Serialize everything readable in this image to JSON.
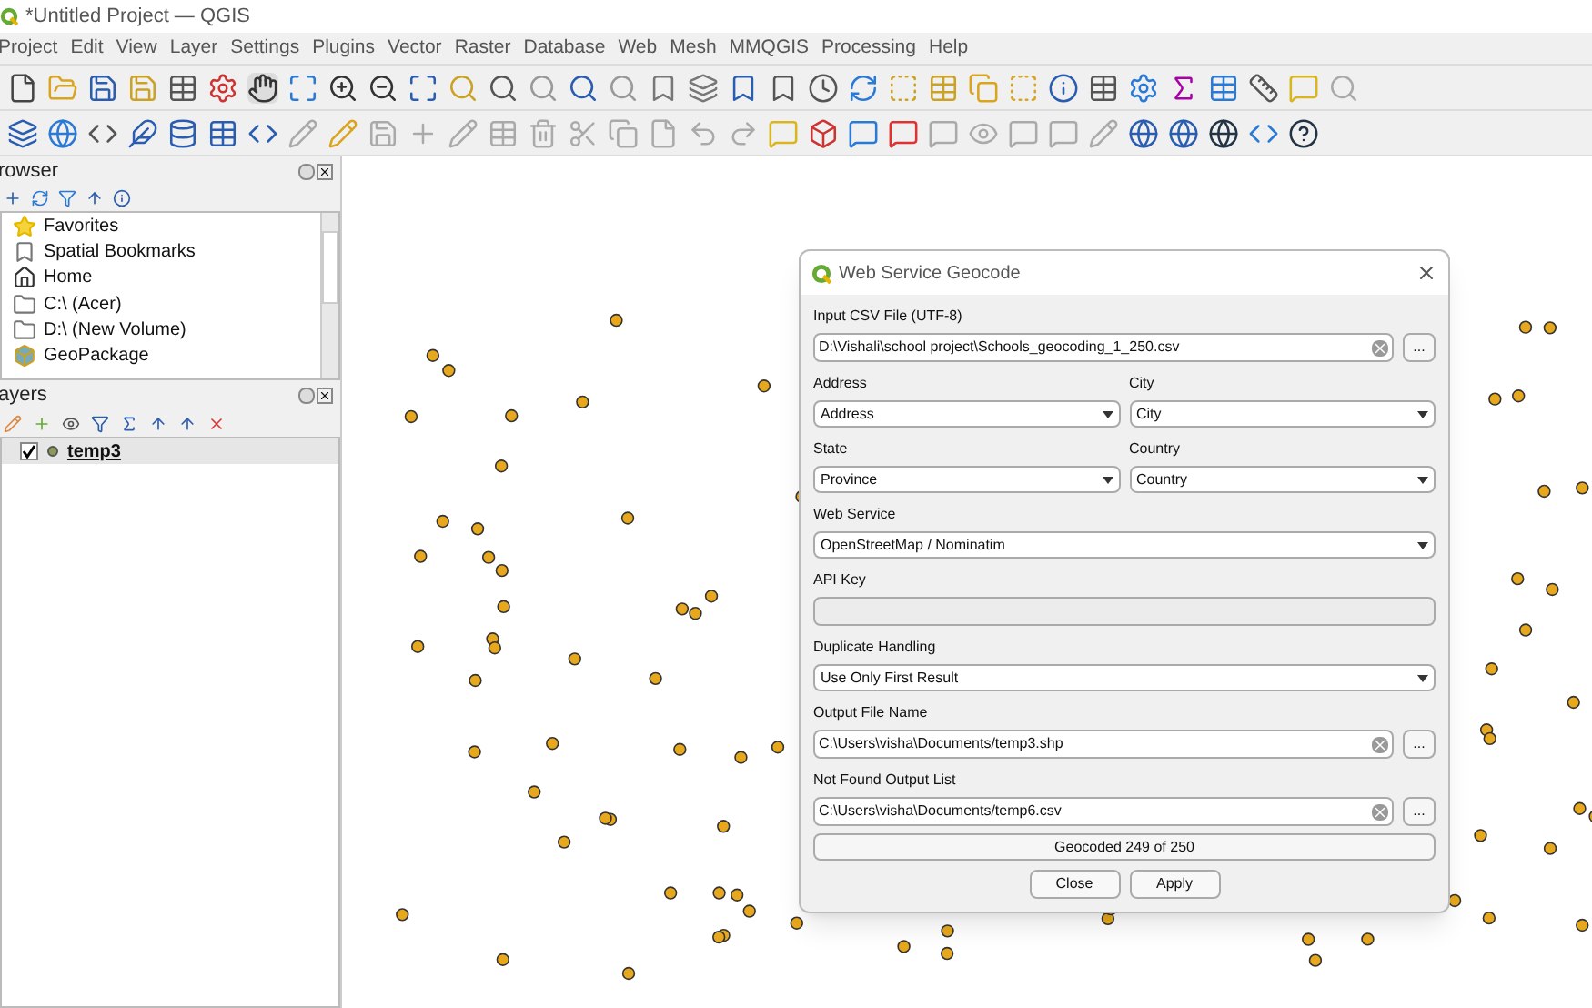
{
  "window": {
    "title": "*Untitled Project — QGIS"
  },
  "menu": [
    "Project",
    "Edit",
    "View",
    "Layer",
    "Settings",
    "Plugins",
    "Vector",
    "Raster",
    "Database",
    "Web",
    "Mesh",
    "MMQGIS",
    "Processing",
    "Help"
  ],
  "browser": {
    "title": "rowser",
    "items": [
      {
        "kind": "star",
        "label": "Favorites"
      },
      {
        "kind": "bookmark",
        "label": "Spatial Bookmarks"
      },
      {
        "kind": "home",
        "label": "Home"
      },
      {
        "kind": "folder",
        "label": "C:\\ (Acer)"
      },
      {
        "kind": "folder",
        "label": "D:\\ (New Volume)"
      },
      {
        "kind": "geopackage",
        "label": "GeoPackage"
      }
    ]
  },
  "layers": {
    "title": "ayers",
    "items": [
      {
        "label": "temp3",
        "checked": true,
        "selected": true
      }
    ]
  },
  "dialog": {
    "title": "Web Service Geocode",
    "input_csv": {
      "label": "Input CSV File (UTF-8)",
      "value": "D:\\Vishali\\school project\\Schools_geocoding_1_250.csv",
      "browse": "..."
    },
    "address": {
      "label": "Address",
      "value": "Address"
    },
    "city": {
      "label": "City",
      "value": "City"
    },
    "state": {
      "label": "State",
      "value": "Province"
    },
    "country": {
      "label": "Country",
      "value": "Country"
    },
    "web_service": {
      "label": "Web Service",
      "value": "OpenStreetMap / Nominatim"
    },
    "api_key": {
      "label": "API Key"
    },
    "duplicate": {
      "label": "Duplicate Handling",
      "value": "Use Only First Result"
    },
    "output_file": {
      "label": "Output File Name",
      "value": "C:\\Users\\visha\\Documents/temp3.shp",
      "browse": "..."
    },
    "not_found": {
      "label": "Not Found Output List",
      "value": "C:\\Users\\visha\\Documents/temp6.csv",
      "browse": "..."
    },
    "status": "Geocoded 249 of 250",
    "buttons": [
      "Close",
      "Apply"
    ]
  }
}
